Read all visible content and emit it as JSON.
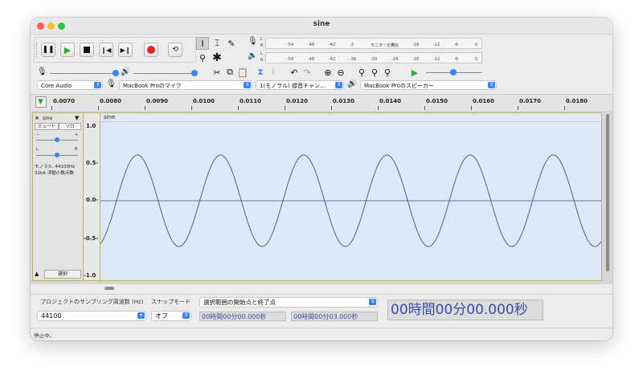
{
  "window": {
    "title": "sine"
  },
  "colors": {
    "wave_bg": "#dde8f8",
    "wave_line": "#40508a",
    "record": "#e0252a",
    "play": "#2eab3a",
    "accent": "#3b82f6"
  },
  "transport": {
    "pause_icon": "pause-icon",
    "play_icon": "play-icon",
    "stop_icon": "stop-icon",
    "skip_start_icon": "skip-start-icon",
    "skip_end_icon": "skip-end-icon",
    "record_icon": "record-icon",
    "loop_icon": "loop-icon"
  },
  "meters": {
    "record_l": "L",
    "record_r": "R",
    "play_l": "L",
    "play_r": "R",
    "record_ticks": [
      "-54",
      "-48",
      "-42",
      "-3",
      "モニターを開始",
      "4",
      "-18",
      "-12",
      "-6",
      "0"
    ],
    "play_ticks": [
      "-54",
      "-48",
      "-42",
      "-36",
      "-30",
      "-24",
      "-18",
      "-12",
      "-6",
      "0"
    ]
  },
  "device": {
    "host": "Core Audio",
    "mic": "MacBook Proのマイク",
    "channels": "1(モノラル) 録音チャン…",
    "speaker": "MacBook Proのスピーカー"
  },
  "ruler": {
    "ticks": [
      "0.0070",
      "0.0080",
      "0.0090",
      "0.0100",
      "0.0110",
      "0.0120",
      "0.0130",
      "0.0140",
      "0.0150",
      "0.0160",
      "0.0170",
      "0.0180"
    ]
  },
  "track": {
    "name": "sine",
    "close": "×",
    "mute": "ミュート",
    "solo": "ソロ",
    "gain_minus": "−",
    "gain_plus": "+",
    "pan_l": "L",
    "pan_r": "R",
    "info_line1": "モノラル, 44100Hz",
    "info_line2": "32bit 浮動小数点数",
    "select": "選択",
    "clip_title": "sine",
    "y_labels": [
      "1.0",
      "0.5-",
      "0.0-",
      "-0.5-",
      "-1.0"
    ]
  },
  "bottom": {
    "rate_label": "プロジェクトのサンプリング周波数 (Hz)",
    "rate_value": "44100",
    "snap_label": "スナップモード",
    "snap_value": "オフ",
    "selection_mode": "選択範囲の開始点と終了点",
    "start_time": "00時間00分00.000秒",
    "end_time": "00時間00分03.000秒",
    "audio_position": "00時間00分00.000秒"
  },
  "status": {
    "text": "停止中。"
  }
}
